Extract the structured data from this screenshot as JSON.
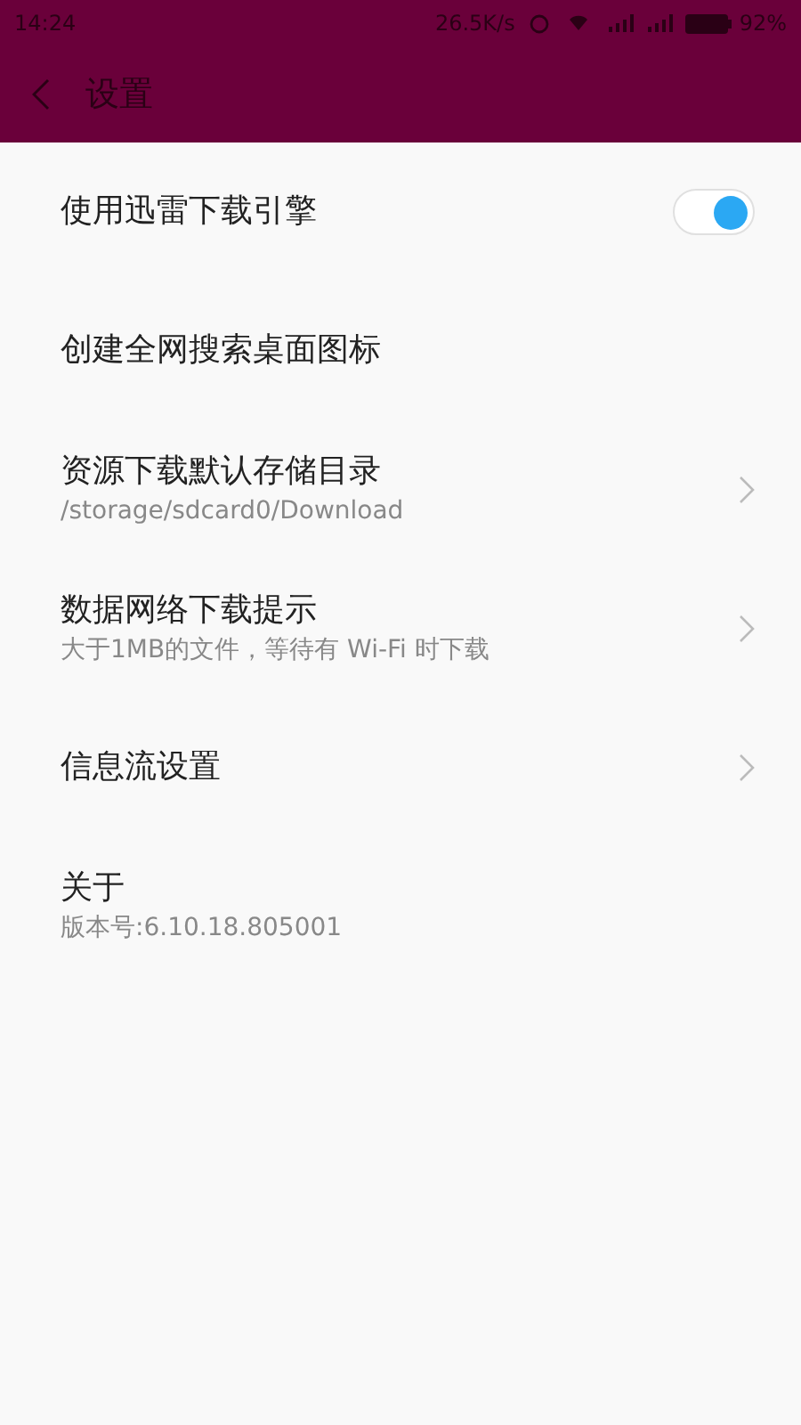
{
  "status_bar": {
    "time": "14:24",
    "speed": "26.5K/s",
    "battery": "92%"
  },
  "header": {
    "title": "设置"
  },
  "items": [
    {
      "kind": "toggle",
      "title": "使用迅雷下载引擎",
      "on": true
    },
    {
      "kind": "plain",
      "title": "创建全网搜索桌面图标"
    },
    {
      "kind": "link",
      "title": "资源下载默认存储目录",
      "subtitle": "/storage/sdcard0/Download"
    },
    {
      "kind": "link",
      "title": "数据网络下载提示",
      "subtitle": "大于1MB的文件，等待有 Wi-Fi 时下载"
    },
    {
      "kind": "link",
      "title": "信息流设置"
    },
    {
      "kind": "plain",
      "title": "关于",
      "subtitle": "版本号:6.10.18.805001"
    }
  ]
}
